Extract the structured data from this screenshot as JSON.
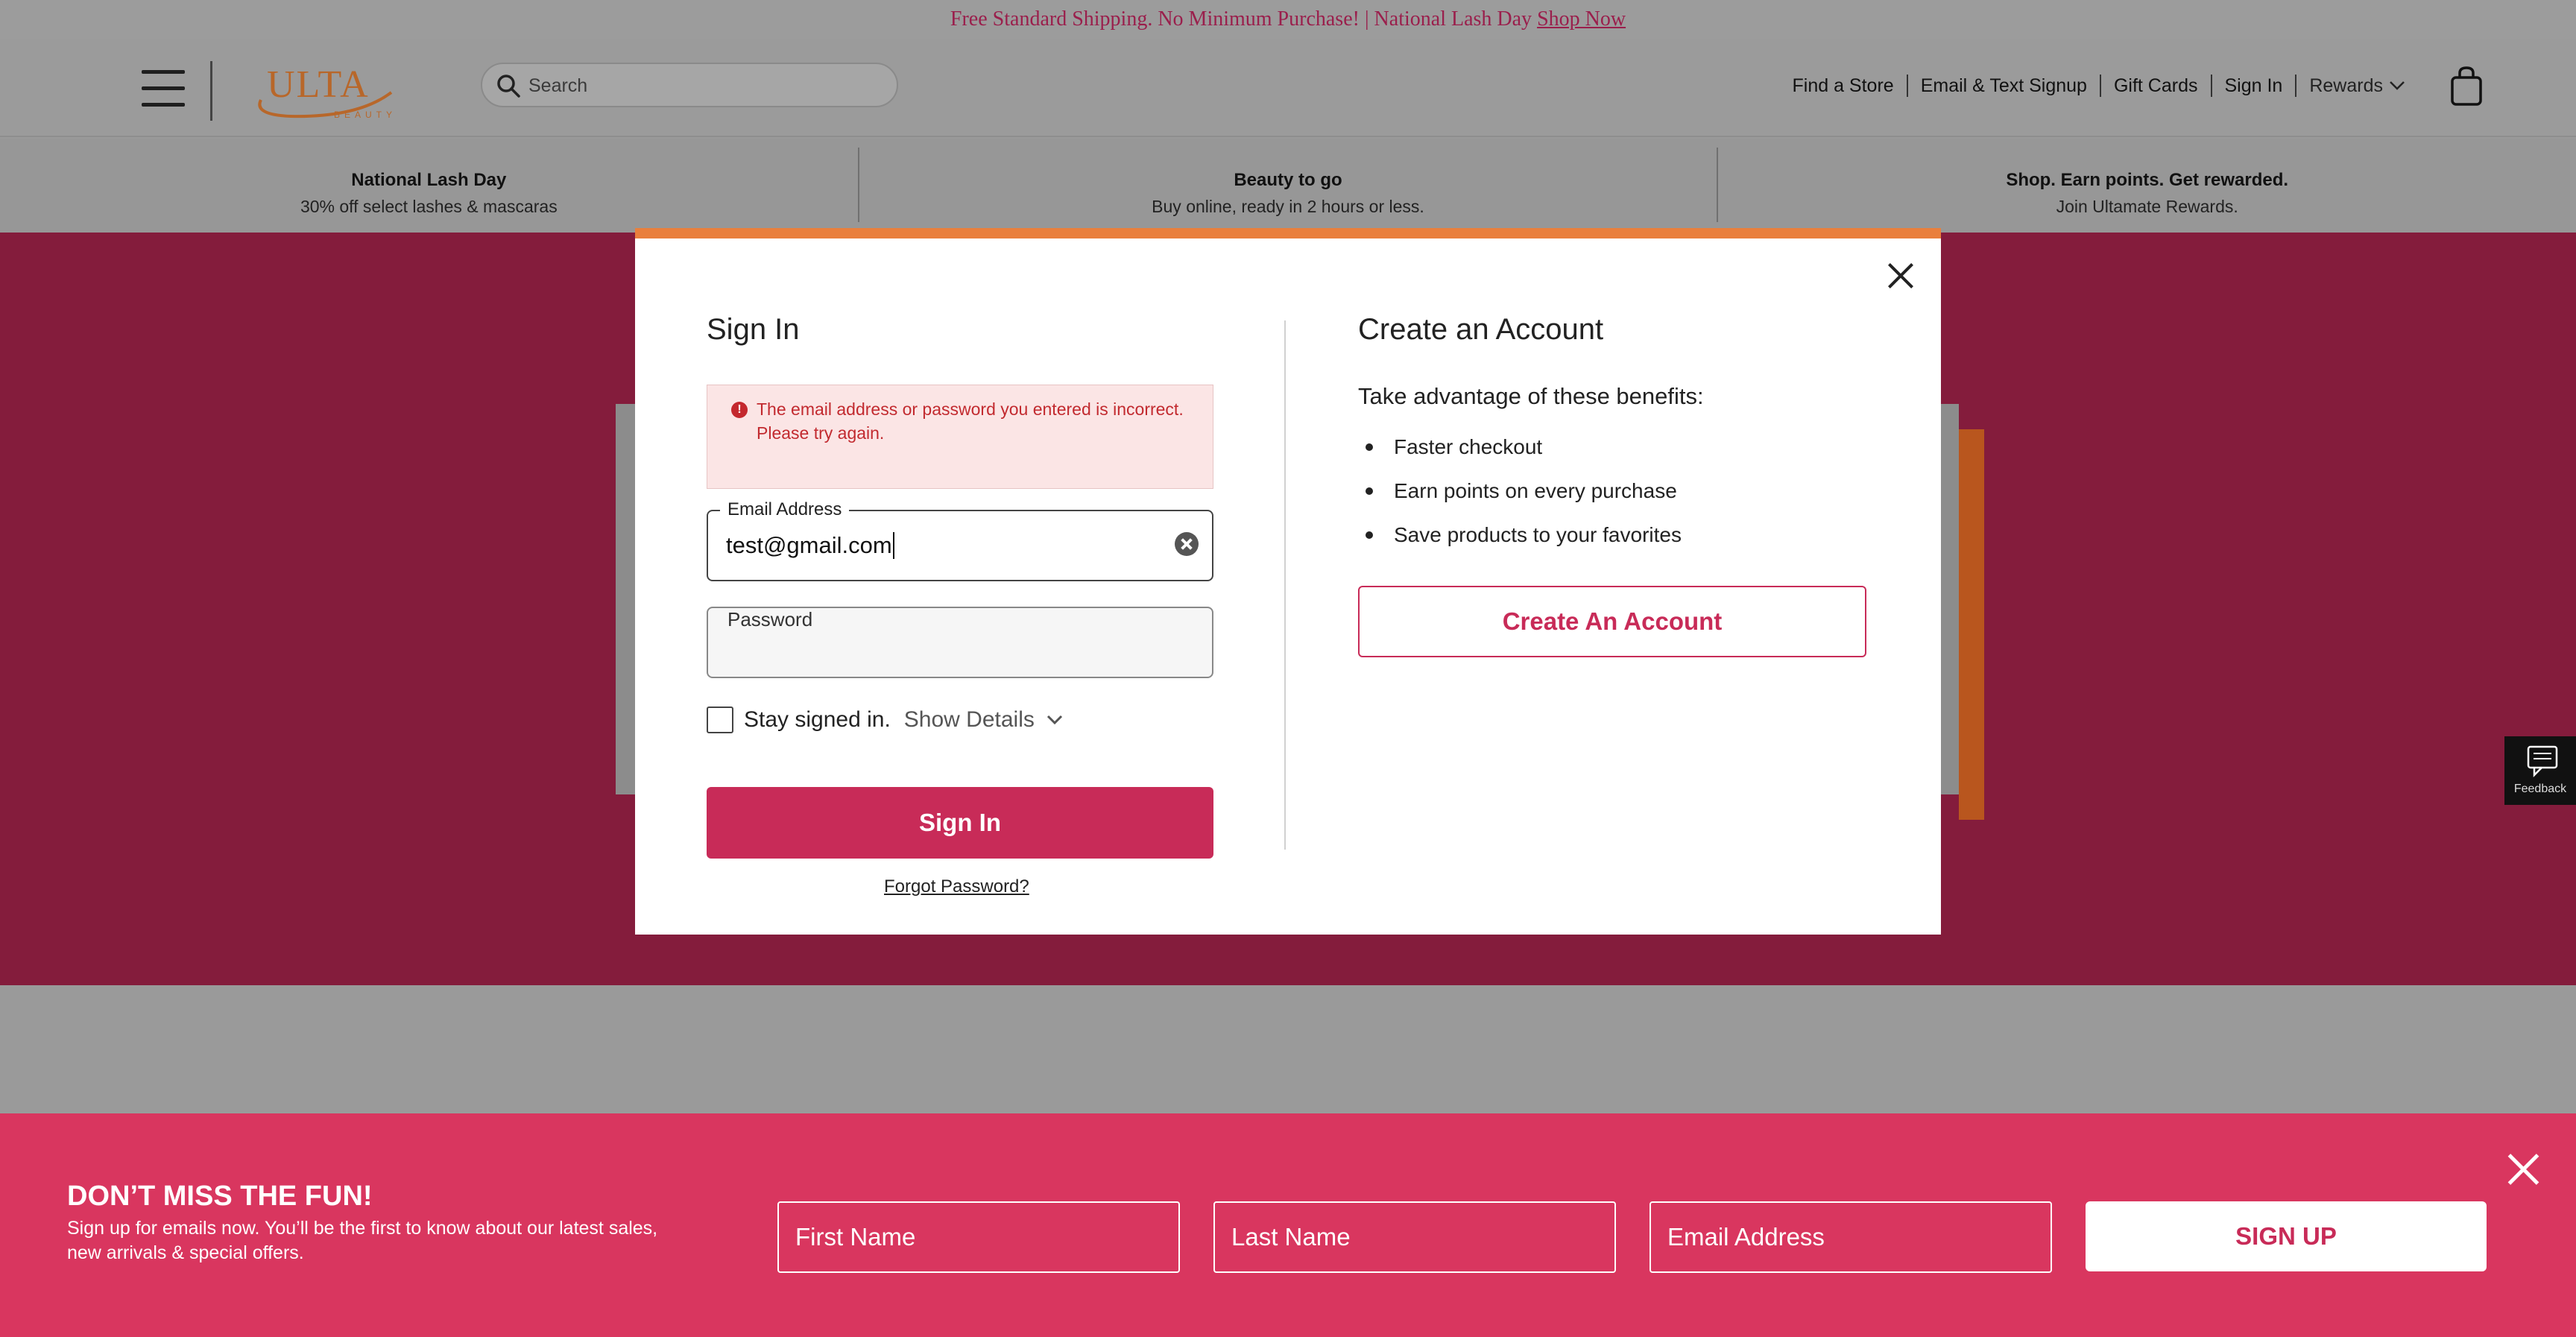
{
  "promo": {
    "text": "Free Standard Shipping. No Minimum Purchase! | National Lash Day",
    "link": "Shop Now"
  },
  "header": {
    "logo_text": "ULTA",
    "logo_sub": "BEAUTY",
    "search_placeholder": "Search",
    "links": [
      "Find a Store",
      "Email & Text Signup",
      "Gift Cards",
      "Sign In"
    ],
    "rewards_label": "Rewards"
  },
  "benefits": [
    {
      "title": "National Lash Day",
      "subtitle": "30% off select lashes & mascaras"
    },
    {
      "title": "Beauty to go",
      "subtitle": "Buy online, ready in 2 hours or less."
    },
    {
      "title": "Shop. Earn points. Get rewarded.",
      "subtitle": "Join Ultamate Rewards."
    }
  ],
  "modal": {
    "signin": {
      "heading": "Sign In",
      "error": "The email address or password you entered is incorrect. Please try again.",
      "email_label": "Email Address",
      "email_value": "test@gmail.com",
      "password_label": "Password",
      "stay_signed_in": "Stay signed in.",
      "show_details": "Show Details",
      "button": "Sign In",
      "forgot": "Forgot Password?"
    },
    "create": {
      "heading": "Create an Account",
      "intro": "Take advantage of these benefits:",
      "benefits": [
        "Faster checkout",
        "Earn points on every purchase",
        "Save products to your favorites"
      ],
      "button": "Create An Account"
    }
  },
  "feedback": {
    "label": "Feedback"
  },
  "signup": {
    "heading": "DON’T MISS THE FUN!",
    "subtext": "Sign up for emails now. You’ll be the first to know about our latest sales, new arrivals & special offers.",
    "first_name": "First Name",
    "last_name": "Last Name",
    "email": "Email Address",
    "button": "SIGN UP"
  },
  "colors": {
    "brand_pink": "#c82b58",
    "modal_accent": "#e97f3d",
    "signup_bg": "#d9365f",
    "hero_bg": "#841c3c"
  }
}
